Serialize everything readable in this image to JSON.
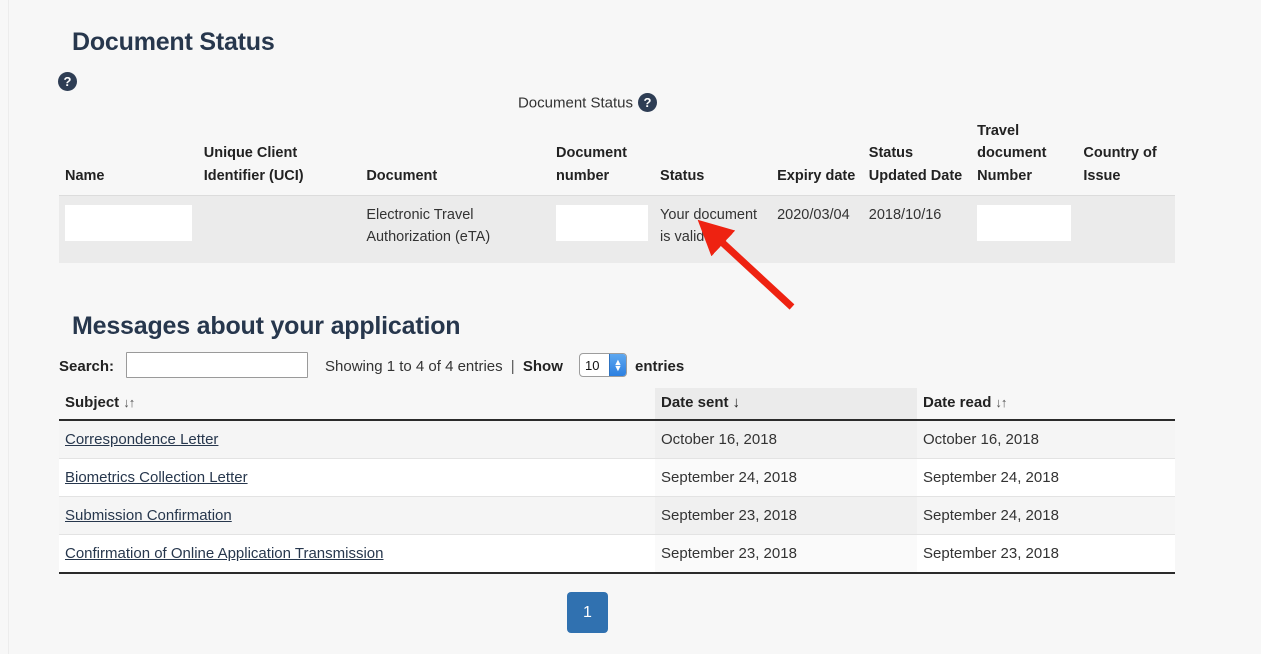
{
  "document_status": {
    "heading": "Document Status",
    "help_icon_glyph": "?",
    "caption": "Document Status",
    "columns": [
      "Name",
      "Unique Client Identifier (UCI)",
      "Document",
      "Document number",
      "Status",
      "Expiry date",
      "Status Updated Date",
      "Travel document Number",
      "Country of Issue"
    ],
    "row": {
      "name": "",
      "uci": "",
      "document": "Electronic Travel Authorization (eTA)",
      "document_number": "",
      "status": "Your document is valid.",
      "expiry_date": "2020/03/04",
      "status_updated_date": "2018/10/16",
      "travel_document_number": "",
      "country_of_issue": ""
    }
  },
  "messages": {
    "heading": "Messages about your application",
    "search_label": "Search:",
    "search_value": "",
    "search_placeholder": "",
    "showing_info": "Showing 1 to 4 of 4 entries",
    "separator": "|",
    "show_label": "Show",
    "length_value": "10",
    "entries_label": "entries",
    "columns": {
      "subject": "Subject",
      "date_sent": "Date sent",
      "date_read": "Date read"
    },
    "sort_indicator_unsorted": "↓↑",
    "sort_indicator_desc": "↓",
    "rows": [
      {
        "subject": "Correspondence Letter",
        "date_sent": "October 16, 2018",
        "date_read": "October 16, 2018"
      },
      {
        "subject": "Biometrics Collection Letter",
        "date_sent": "September 24, 2018",
        "date_read": "September 24, 2018"
      },
      {
        "subject": "Submission Confirmation",
        "date_sent": "September 23, 2018",
        "date_read": "September 24, 2018"
      },
      {
        "subject": "Confirmation of Online Application Transmission",
        "date_sent": "September 23, 2018",
        "date_read": "September 23, 2018"
      }
    ],
    "pagination": {
      "current_page": "1"
    }
  },
  "annotation": {
    "type": "arrow",
    "color": "#ee2211",
    "points_at": "status-cell-value"
  },
  "colors": {
    "heading": "#27374d",
    "help_icon_bg": "#2e3d54",
    "link": "#27374d",
    "page_button": "#3071b0",
    "row_alt": "#f5f5f5",
    "doc_row_bg": "#ebebeb",
    "page_bg": "#f7f7f7"
  }
}
